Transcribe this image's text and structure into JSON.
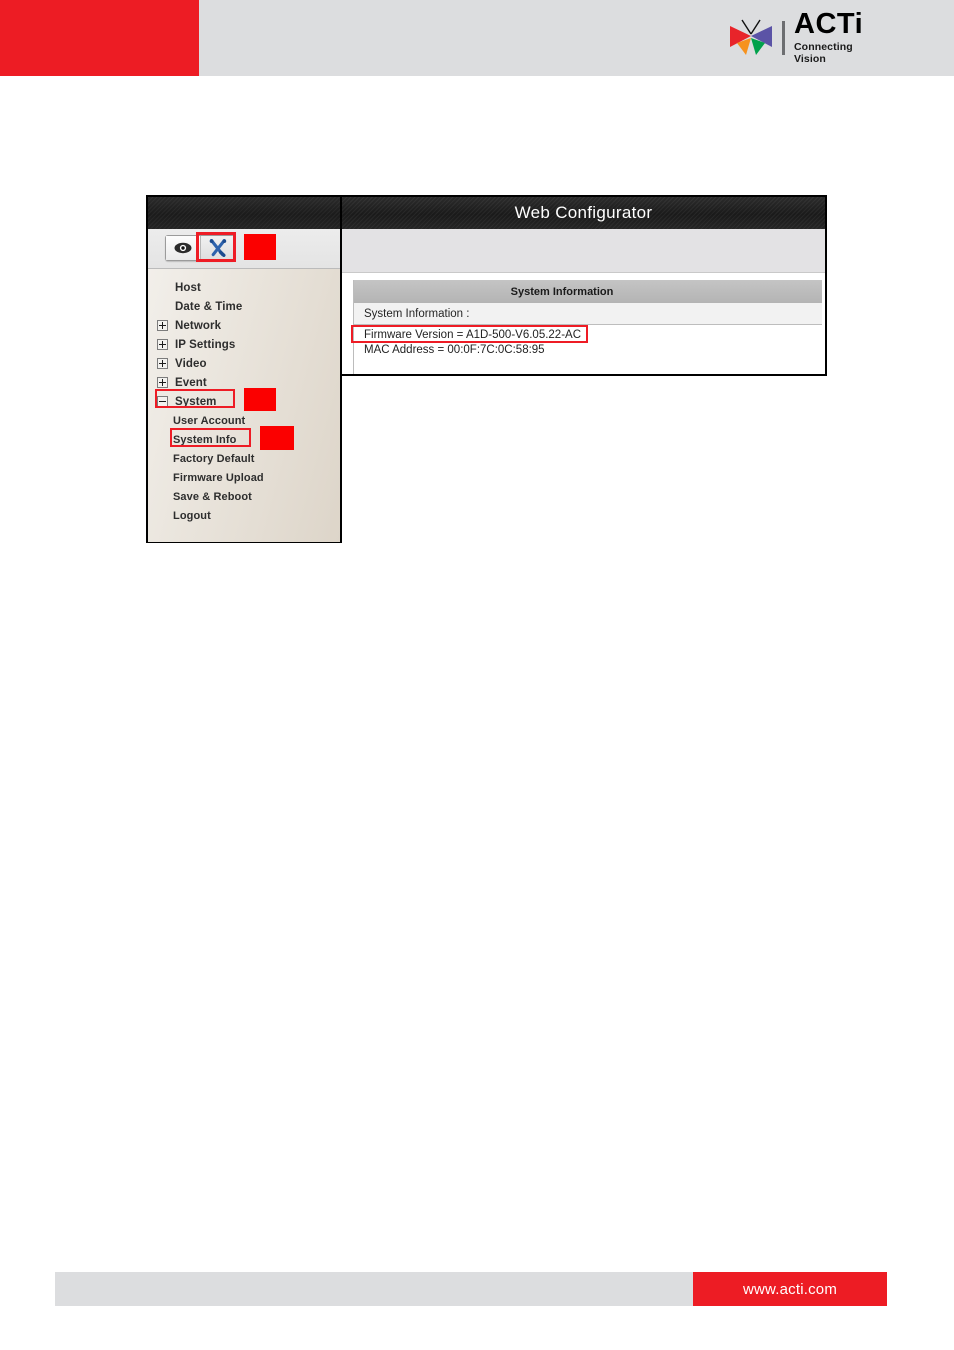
{
  "header": {
    "brand": {
      "name": "ACTi",
      "tagline": "Connecting Vision",
      "logo_icon": "acti-butterfly-logo",
      "colors": {
        "red": "#ed1c24",
        "purple": "#5b53a6",
        "orange": "#f6921e",
        "green": "#00a14b"
      }
    },
    "banner_color": "#ed1c24",
    "background_color": "#dcdddf"
  },
  "screenshot": {
    "device_panel": {
      "toolbar": {
        "buttons": [
          {
            "name": "live-view",
            "icon": "eye-icon",
            "active": false
          },
          {
            "name": "settings",
            "icon": "tools-icon",
            "active": true
          }
        ],
        "highlight_color": "#ee1c25",
        "marker_color": "#fb0000"
      },
      "menu": {
        "items": [
          {
            "label": "Host",
            "expander": "none",
            "level": 0
          },
          {
            "label": "Date & Time",
            "expander": "none",
            "level": 0
          },
          {
            "label": "Network",
            "expander": "plus",
            "level": 0
          },
          {
            "label": "IP Settings",
            "expander": "plus",
            "level": 0
          },
          {
            "label": "Video",
            "expander": "plus",
            "level": 0
          },
          {
            "label": "Event",
            "expander": "plus",
            "level": 0
          },
          {
            "label": "System",
            "expander": "minus",
            "level": 0,
            "highlighted": true
          },
          {
            "label": "User Account",
            "expander": "none",
            "level": 1
          },
          {
            "label": "System Info",
            "expander": "none",
            "level": 1,
            "highlighted": true,
            "selected": true
          },
          {
            "label": "Factory Default",
            "expander": "none",
            "level": 1
          },
          {
            "label": "Firmware Upload",
            "expander": "none",
            "level": 1
          },
          {
            "label": "Save & Reboot",
            "expander": "none",
            "level": 1
          },
          {
            "label": "Logout",
            "expander": "none",
            "level": 1
          }
        ]
      }
    },
    "content_panel": {
      "title": "Web Configurator",
      "card_title": "System Information",
      "section_label": "System Information :",
      "lines": [
        "Firmware Version = A1D-500-V6.05.22-AC",
        "MAC Address = 00:0F:7C:0C:58:95"
      ],
      "firmware_highlighted": true
    }
  },
  "footer": {
    "url": "www.acti.com",
    "bar_color": "#dcdddf",
    "url_block_color": "#ed1c24"
  }
}
